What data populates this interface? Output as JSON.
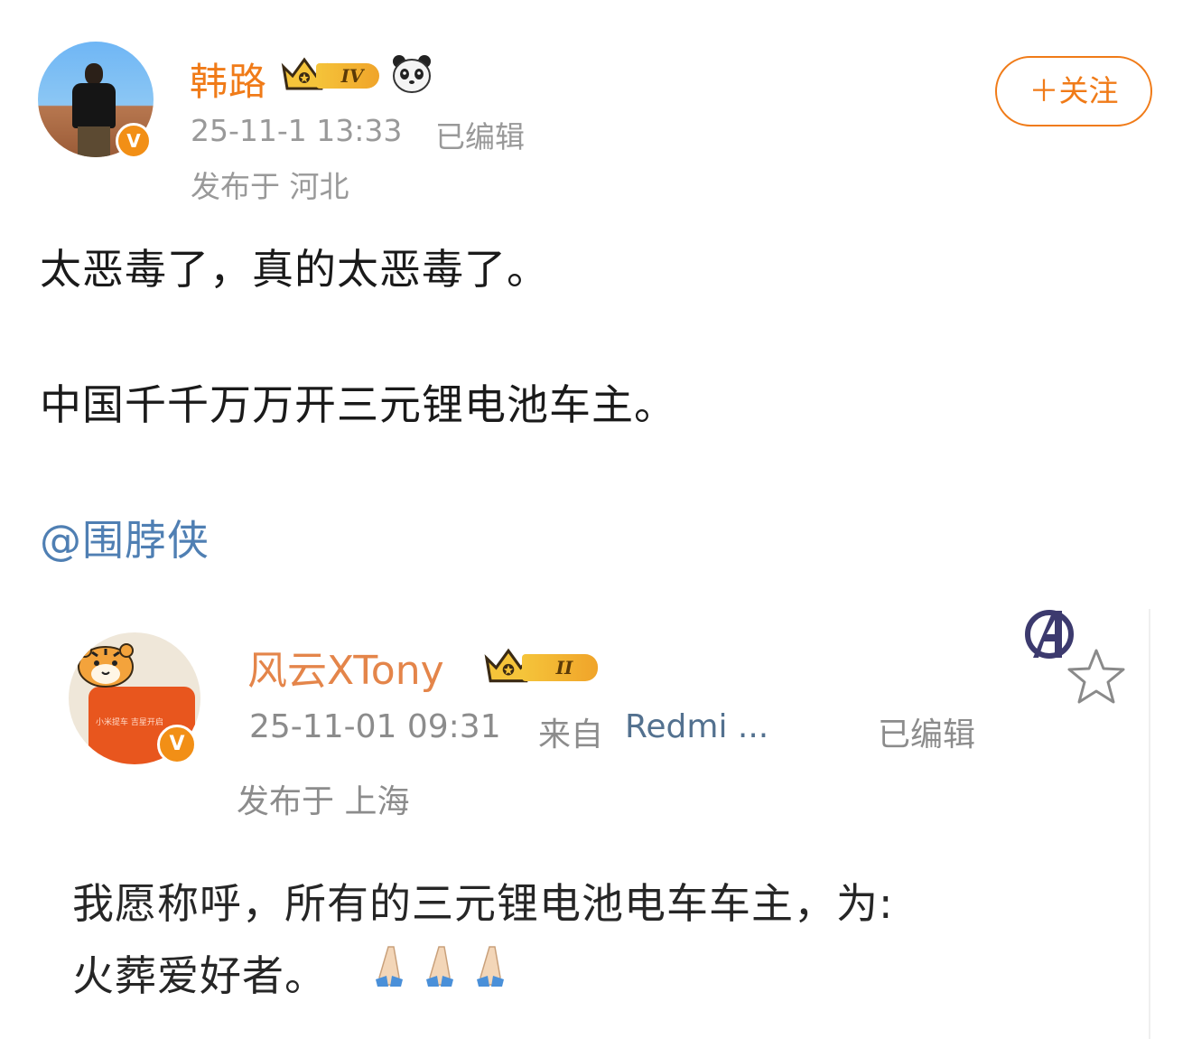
{
  "post": {
    "author": {
      "name": "韩路",
      "level_badge": "IV",
      "verified_mark": "V",
      "avatar_icon": "user-avatar",
      "extra_icon": "panda-icon"
    },
    "time": "25-11-1 13:33",
    "edited_label": "已编辑",
    "location": "发布于 河北",
    "follow_label": "＋关注",
    "body_lines": [
      "太恶毒了，真的太恶毒了。",
      "中国千千万万开三元锂电池车主。"
    ],
    "mention": "@围脖侠"
  },
  "embedded_post": {
    "author": {
      "name": "风云XTony",
      "level_badge": "II",
      "verified_mark": "V",
      "avatar_icon": "tiger-avatar",
      "avatar_box_text": "小米提车 吉星开启"
    },
    "time": "25-11-01 09:31",
    "source_label": "来自",
    "source": "Redmi ...",
    "edited_label": "已编辑",
    "location": "发布于 上海",
    "body_lines": [
      "我愿称呼，所有的三元锂电池电车车主，为:",
      "火葬爱好者。"
    ],
    "emoji": "🙏🙏🙏",
    "icons": [
      "avengers-icon",
      "star-icon"
    ]
  },
  "colors": {
    "brand_orange": "#f07b18",
    "embed_name": "#e4854a",
    "mention_blue": "#4f7fb3",
    "meta_gray": "#999999"
  }
}
